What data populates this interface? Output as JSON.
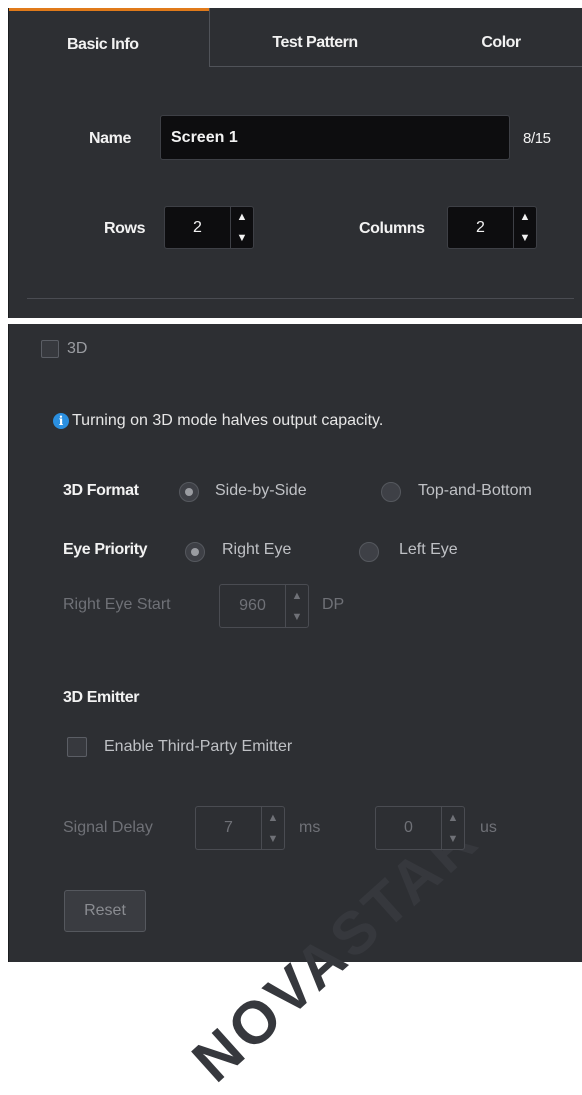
{
  "tabs": [
    {
      "label": "Basic Info",
      "active": true
    },
    {
      "label": "Test Pattern",
      "active": false
    },
    {
      "label": "Color",
      "active": false
    }
  ],
  "basic": {
    "name_label": "Name",
    "name_value": "Screen 1",
    "name_count": "8/15",
    "rows_label": "Rows",
    "rows_value": "2",
    "columns_label": "Columns",
    "columns_value": "2"
  },
  "threeD": {
    "checkbox_label": "3D",
    "checked": false,
    "info_text": "Turning on 3D mode halves output capacity.",
    "format_label": "3D Format",
    "format_options": [
      "Side-by-Side",
      "Top-and-Bottom"
    ],
    "format_selected": "Side-by-Side",
    "eye_priority_label": "Eye Priority",
    "eye_options": [
      "Right Eye",
      "Left Eye"
    ],
    "eye_selected": "Right Eye",
    "right_eye_start_label": "Right Eye Start",
    "right_eye_start_value": "960",
    "right_eye_start_unit": "DP",
    "emitter_heading": "3D Emitter",
    "emitter_checkbox_label": "Enable Third-Party Emitter",
    "signal_delay_label": "Signal Delay",
    "signal_delay_ms_value": "7",
    "signal_delay_ms_unit": "ms",
    "signal_delay_us_value": "0",
    "signal_delay_us_unit": "us",
    "reset_label": "Reset"
  },
  "watermark": "NOVASTAR",
  "colors": {
    "accent": "#e07a1a",
    "panel": "#2d2f33",
    "info": "#2a8fe0"
  }
}
